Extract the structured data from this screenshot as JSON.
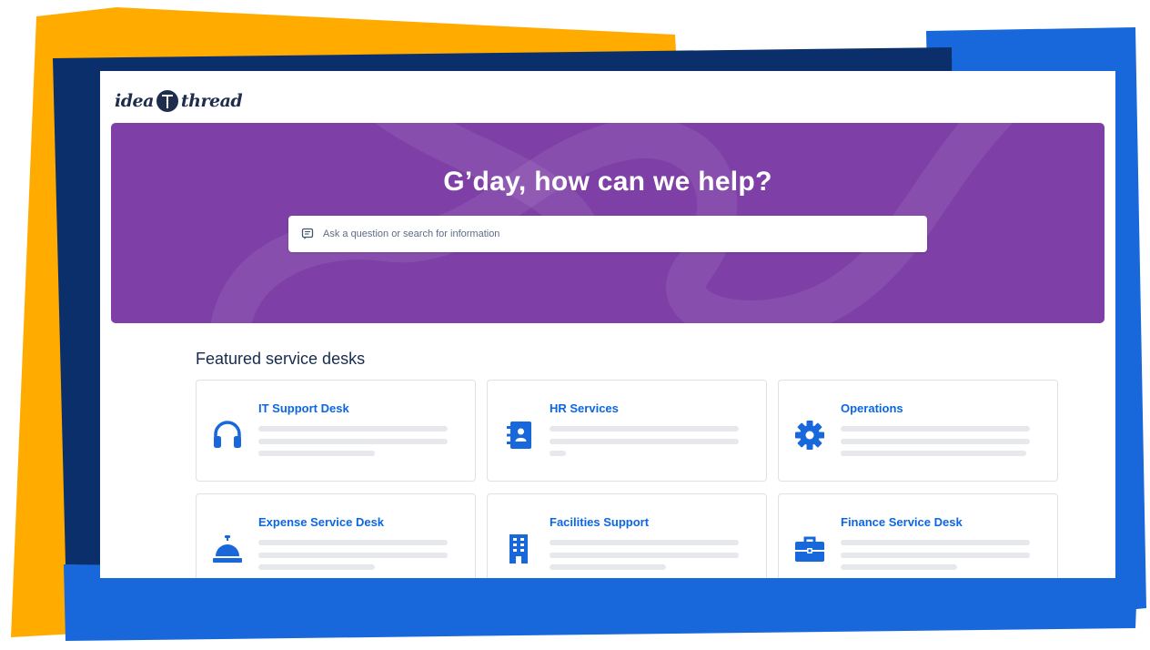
{
  "brand": {
    "logo_left": "idea",
    "logo_right": "thread",
    "colors": {
      "orange": "#ffab00",
      "navy": "#0b2f6b",
      "blue": "#1868db",
      "purple": "#7e3fa6",
      "link": "#0c66e4"
    }
  },
  "hero": {
    "title": "G’day, how can we help?",
    "search_placeholder": "Ask a question or search for information",
    "search_icon": "chat-bubble-icon"
  },
  "featured": {
    "heading": "Featured service desks",
    "desks": [
      {
        "name": "IT Support Desk",
        "icon": "headset-icon"
      },
      {
        "name": "HR Services",
        "icon": "contact-book-icon"
      },
      {
        "name": "Operations",
        "icon": "gear-icon"
      },
      {
        "name": "Expense Service Desk",
        "icon": "service-bell-icon"
      },
      {
        "name": "Facilities Support",
        "icon": "office-building-icon"
      },
      {
        "name": "Finance Service Desk",
        "icon": "briefcase-icon"
      }
    ]
  }
}
